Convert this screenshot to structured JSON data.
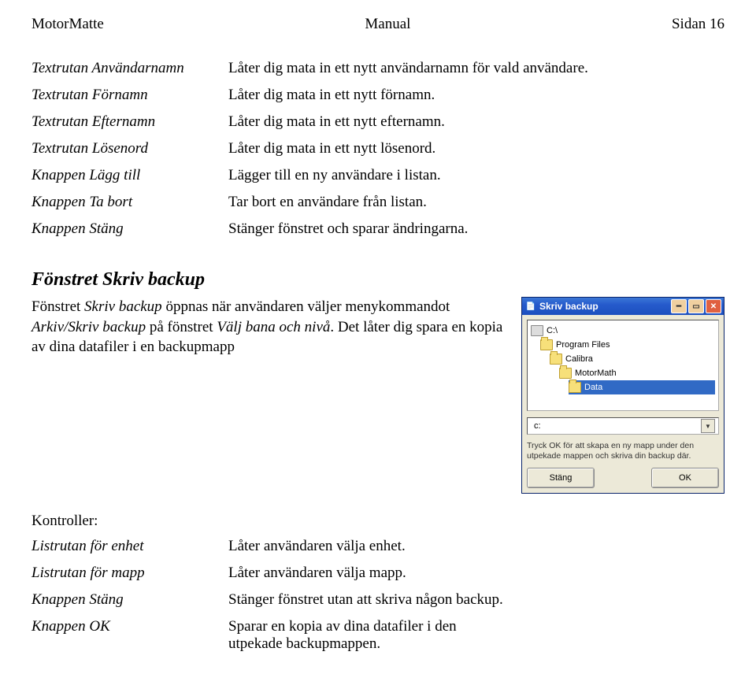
{
  "header": {
    "left": "MotorMatte",
    "center": "Manual",
    "right": "Sidan 16"
  },
  "defs1": [
    {
      "term": "Textrutan Användarnamn",
      "desc": "Låter dig mata in ett nytt användarnamn för vald användare."
    },
    {
      "term": "Textrutan Förnamn",
      "desc": "Låter dig mata in ett nytt förnamn."
    },
    {
      "term": "Textrutan Efternamn",
      "desc": "Låter dig mata in ett nytt efternamn."
    },
    {
      "term": "Textrutan Lösenord",
      "desc": "Låter dig mata in ett nytt lösenord."
    },
    {
      "term": "Knappen Lägg till",
      "desc": "Lägger till en ny användare i listan."
    },
    {
      "term": "Knappen Ta bort",
      "desc": "Tar bort en användare från listan."
    },
    {
      "term": "Knappen Stäng",
      "desc": "Stänger fönstret och sparar ändringarna."
    }
  ],
  "section": {
    "title": "Fönstret Skriv backup",
    "body_pre": "Fönstret ",
    "body_em1": "Skriv backup",
    "body_mid": " öppnas när användaren väljer menykommandot ",
    "body_em2": "Arkiv/Skriv backup",
    "body_mid2": " på fönstret ",
    "body_em3": "Välj bana och nivå",
    "body_post": ". Det låter dig spara en kopia av dina datafiler i en backupmapp"
  },
  "controls_label": "Kontroller:",
  "defs2": [
    {
      "term": "Listrutan för enhet",
      "desc": "Låter användaren välja enhet."
    },
    {
      "term": "Listrutan för mapp",
      "desc": "Låter användaren välja mapp."
    },
    {
      "term": "Knappen Stäng",
      "desc": "Stänger fönstret utan att skriva någon backup."
    },
    {
      "term": "Knappen OK",
      "desc": "Sparar en kopia av dina datafiler i den utpekade backupmappen."
    }
  ],
  "mock": {
    "title": "Skriv backup",
    "tree": [
      {
        "label": "C:\\",
        "indent": 0,
        "icon": "drive",
        "sel": false
      },
      {
        "label": "Program Files",
        "indent": 1,
        "icon": "folder",
        "sel": false
      },
      {
        "label": "Calibra",
        "indent": 2,
        "icon": "folder",
        "sel": false
      },
      {
        "label": "MotorMath",
        "indent": 3,
        "icon": "folder",
        "sel": false
      },
      {
        "label": "Data",
        "indent": 4,
        "icon": "folder",
        "sel": true
      }
    ],
    "drive": "c:",
    "hint": "Tryck OK för att skapa en ny mapp under den utpekade mappen och skriva din backup där.",
    "btn_close": "Stäng",
    "btn_ok": "OK"
  }
}
